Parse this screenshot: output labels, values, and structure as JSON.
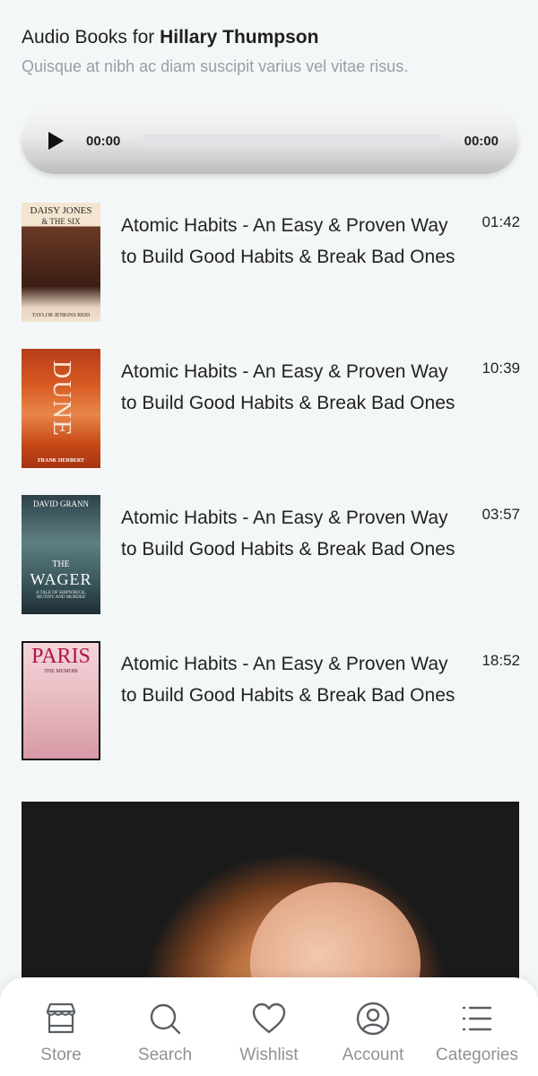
{
  "header": {
    "title_prefix": "Audio Books for ",
    "title_name": "Hillary Thumpson",
    "subtitle": "Quisque at nibh ac diam suscipit varius vel vitae risus."
  },
  "player": {
    "current_time": "00:00",
    "total_time": "00:00",
    "progress": 0,
    "icon": "play-icon"
  },
  "books": [
    {
      "title": "Atomic Habits - An Easy & Proven Way to Build Good Habits & Break Bad Ones",
      "duration": "01:42",
      "cover": {
        "top": "DAISY JONES",
        "sub": "& THE SIX",
        "bottom": "TAYLOR JENKINS REID"
      }
    },
    {
      "title": "Atomic Habits - An Easy & Proven Way to Build Good Habits & Break Bad Ones",
      "duration": "10:39",
      "cover": {
        "top": "DUNE",
        "bottom": "FRANK HERBERT"
      }
    },
    {
      "title": "Atomic Habits - An Easy & Proven Way to Build Good Habits & Break Bad Ones",
      "duration": "03:57",
      "cover": {
        "top": "DAVID GRANN",
        "mid": "THE",
        "main": "WAGER",
        "bottom": "A TALE OF SHIPWRECK, MUTINY AND MURDER"
      }
    },
    {
      "title": "Atomic Habits - An Easy & Proven Way to Build Good Habits & Break Bad Ones",
      "duration": "18:52",
      "cover": {
        "top": "PARIS",
        "sub": "THE MEMOIR"
      }
    }
  ],
  "tabs": [
    {
      "label": "Store",
      "icon": "store-icon"
    },
    {
      "label": "Search",
      "icon": "search-icon"
    },
    {
      "label": "Wishlist",
      "icon": "heart-icon"
    },
    {
      "label": "Account",
      "icon": "account-icon"
    },
    {
      "label": "Categories",
      "icon": "menu-icon"
    }
  ],
  "colors": {
    "background": "#f4f7f8",
    "tab_label": "#8e9296",
    "subtitle": "#9a9ea2"
  }
}
